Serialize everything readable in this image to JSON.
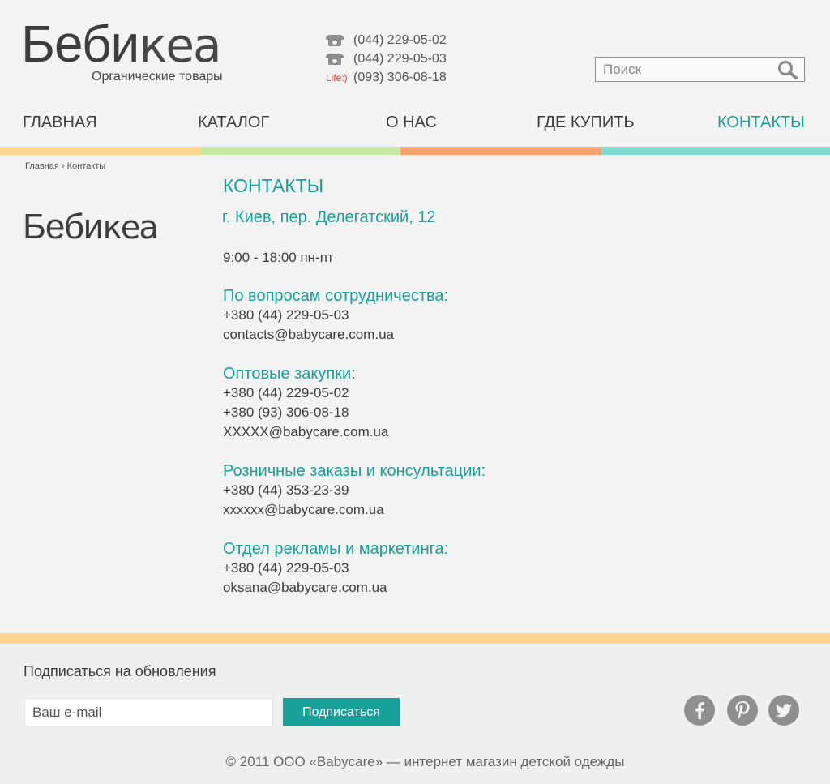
{
  "header": {
    "logo_part1": "Беби",
    "logo_part2": "кеа",
    "tagline": "Органические товары",
    "phones": [
      {
        "prefix": "",
        "number": "(044) 229-05-02",
        "icon": "phone-icon"
      },
      {
        "prefix": "",
        "number": "(044) 229-05-03",
        "icon": "phone-icon"
      },
      {
        "prefix": "Life:)",
        "number": "(093) 306-08-18",
        "icon": ""
      }
    ],
    "search": {
      "placeholder": "Поиск",
      "icon": "search-icon"
    }
  },
  "nav": {
    "items": [
      {
        "label": "ГЛАВНАЯ",
        "active": false
      },
      {
        "label": "КАТАЛОГ",
        "active": false
      },
      {
        "label": "О НАС",
        "active": false
      },
      {
        "label": "ГДЕ КУПИТЬ",
        "active": false
      },
      {
        "label": "КОНТАКТЫ",
        "active": true
      }
    ],
    "stripe_colors": [
      "#fdd58c",
      "#c5e8a3",
      "#fda26f",
      "#7fdbd0"
    ]
  },
  "breadcrumb": {
    "home": "Главная",
    "separator": "›",
    "current": "Контакты"
  },
  "sidebar": {
    "logo_part1": "Беби",
    "logo_part2": "кеа"
  },
  "content": {
    "title": "КОНТАКТЫ",
    "address": "г. Киев, пер. Делегатский, 12",
    "hours": "9:00 - 18:00 пн-пт",
    "sections": [
      {
        "heading": "По вопросам сотрудничества:",
        "lines": [
          "+380 (44) 229-05-03",
          "contacts@babycare.com.ua"
        ]
      },
      {
        "heading": "Оптовые закупки:",
        "lines": [
          "+380 (44) 229-05-02",
          "+380 (93) 306-08-18",
          "XXXXX@babycare.com.ua"
        ]
      },
      {
        "heading": "Розничные заказы и консультации:",
        "lines": [
          "+380 (44) 353-23-39",
          "xxxxxx@babycare.com.ua"
        ]
      },
      {
        "heading": "Отдел рекламы и маркетинга:",
        "lines": [
          "+380 (44) 229-05-03",
          "oksana@babycare.com.ua"
        ]
      }
    ]
  },
  "footer": {
    "subscribe_title": "Подписаться на обновления",
    "email_placeholder": "Ваш e-mail",
    "subscribe_button": "Подписаться",
    "social": [
      "facebook-icon",
      "pinterest-icon",
      "twitter-icon"
    ],
    "copyright": "© 2011 ООО «Babycare» — интернет магазин детской одежды"
  },
  "colors": {
    "accent": "#17a299",
    "button": "#16a19a",
    "life_red": "#e0342c",
    "footer_stripe": "#fdd58c"
  }
}
